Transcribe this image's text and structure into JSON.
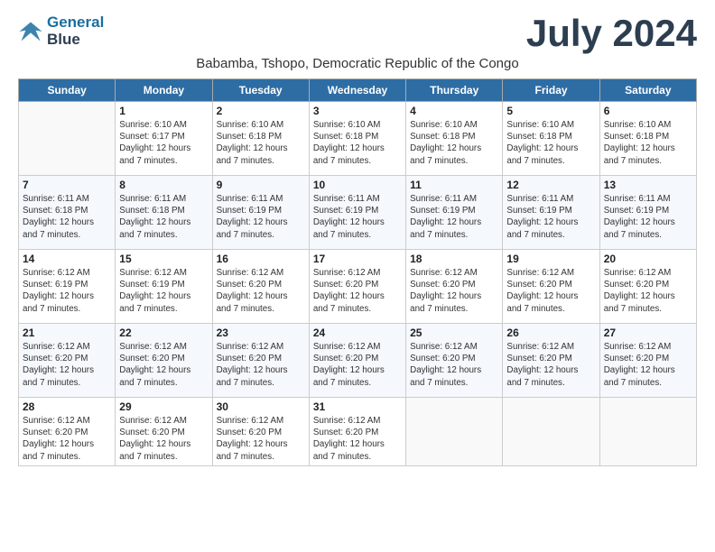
{
  "logo": {
    "line1": "General",
    "line2": "Blue"
  },
  "title": "July 2024",
  "subtitle": "Babamba, Tshopo, Democratic Republic of the Congo",
  "days_of_week": [
    "Sunday",
    "Monday",
    "Tuesday",
    "Wednesday",
    "Thursday",
    "Friday",
    "Saturday"
  ],
  "weeks": [
    [
      {
        "num": "",
        "info": ""
      },
      {
        "num": "1",
        "info": "Sunrise: 6:10 AM\nSunset: 6:17 PM\nDaylight: 12 hours\nand 7 minutes."
      },
      {
        "num": "2",
        "info": "Sunrise: 6:10 AM\nSunset: 6:18 PM\nDaylight: 12 hours\nand 7 minutes."
      },
      {
        "num": "3",
        "info": "Sunrise: 6:10 AM\nSunset: 6:18 PM\nDaylight: 12 hours\nand 7 minutes."
      },
      {
        "num": "4",
        "info": "Sunrise: 6:10 AM\nSunset: 6:18 PM\nDaylight: 12 hours\nand 7 minutes."
      },
      {
        "num": "5",
        "info": "Sunrise: 6:10 AM\nSunset: 6:18 PM\nDaylight: 12 hours\nand 7 minutes."
      },
      {
        "num": "6",
        "info": "Sunrise: 6:10 AM\nSunset: 6:18 PM\nDaylight: 12 hours\nand 7 minutes."
      }
    ],
    [
      {
        "num": "7",
        "info": "Sunrise: 6:11 AM\nSunset: 6:18 PM\nDaylight: 12 hours\nand 7 minutes."
      },
      {
        "num": "8",
        "info": "Sunrise: 6:11 AM\nSunset: 6:18 PM\nDaylight: 12 hours\nand 7 minutes."
      },
      {
        "num": "9",
        "info": "Sunrise: 6:11 AM\nSunset: 6:19 PM\nDaylight: 12 hours\nand 7 minutes."
      },
      {
        "num": "10",
        "info": "Sunrise: 6:11 AM\nSunset: 6:19 PM\nDaylight: 12 hours\nand 7 minutes."
      },
      {
        "num": "11",
        "info": "Sunrise: 6:11 AM\nSunset: 6:19 PM\nDaylight: 12 hours\nand 7 minutes."
      },
      {
        "num": "12",
        "info": "Sunrise: 6:11 AM\nSunset: 6:19 PM\nDaylight: 12 hours\nand 7 minutes."
      },
      {
        "num": "13",
        "info": "Sunrise: 6:11 AM\nSunset: 6:19 PM\nDaylight: 12 hours\nand 7 minutes."
      }
    ],
    [
      {
        "num": "14",
        "info": "Sunrise: 6:12 AM\nSunset: 6:19 PM\nDaylight: 12 hours\nand 7 minutes."
      },
      {
        "num": "15",
        "info": "Sunrise: 6:12 AM\nSunset: 6:19 PM\nDaylight: 12 hours\nand 7 minutes."
      },
      {
        "num": "16",
        "info": "Sunrise: 6:12 AM\nSunset: 6:20 PM\nDaylight: 12 hours\nand 7 minutes."
      },
      {
        "num": "17",
        "info": "Sunrise: 6:12 AM\nSunset: 6:20 PM\nDaylight: 12 hours\nand 7 minutes."
      },
      {
        "num": "18",
        "info": "Sunrise: 6:12 AM\nSunset: 6:20 PM\nDaylight: 12 hours\nand 7 minutes."
      },
      {
        "num": "19",
        "info": "Sunrise: 6:12 AM\nSunset: 6:20 PM\nDaylight: 12 hours\nand 7 minutes."
      },
      {
        "num": "20",
        "info": "Sunrise: 6:12 AM\nSunset: 6:20 PM\nDaylight: 12 hours\nand 7 minutes."
      }
    ],
    [
      {
        "num": "21",
        "info": "Sunrise: 6:12 AM\nSunset: 6:20 PM\nDaylight: 12 hours\nand 7 minutes."
      },
      {
        "num": "22",
        "info": "Sunrise: 6:12 AM\nSunset: 6:20 PM\nDaylight: 12 hours\nand 7 minutes."
      },
      {
        "num": "23",
        "info": "Sunrise: 6:12 AM\nSunset: 6:20 PM\nDaylight: 12 hours\nand 7 minutes."
      },
      {
        "num": "24",
        "info": "Sunrise: 6:12 AM\nSunset: 6:20 PM\nDaylight: 12 hours\nand 7 minutes."
      },
      {
        "num": "25",
        "info": "Sunrise: 6:12 AM\nSunset: 6:20 PM\nDaylight: 12 hours\nand 7 minutes."
      },
      {
        "num": "26",
        "info": "Sunrise: 6:12 AM\nSunset: 6:20 PM\nDaylight: 12 hours\nand 7 minutes."
      },
      {
        "num": "27",
        "info": "Sunrise: 6:12 AM\nSunset: 6:20 PM\nDaylight: 12 hours\nand 7 minutes."
      }
    ],
    [
      {
        "num": "28",
        "info": "Sunrise: 6:12 AM\nSunset: 6:20 PM\nDaylight: 12 hours\nand 7 minutes."
      },
      {
        "num": "29",
        "info": "Sunrise: 6:12 AM\nSunset: 6:20 PM\nDaylight: 12 hours\nand 7 minutes."
      },
      {
        "num": "30",
        "info": "Sunrise: 6:12 AM\nSunset: 6:20 PM\nDaylight: 12 hours\nand 7 minutes."
      },
      {
        "num": "31",
        "info": "Sunrise: 6:12 AM\nSunset: 6:20 PM\nDaylight: 12 hours\nand 7 minutes."
      },
      {
        "num": "",
        "info": ""
      },
      {
        "num": "",
        "info": ""
      },
      {
        "num": "",
        "info": ""
      }
    ]
  ]
}
